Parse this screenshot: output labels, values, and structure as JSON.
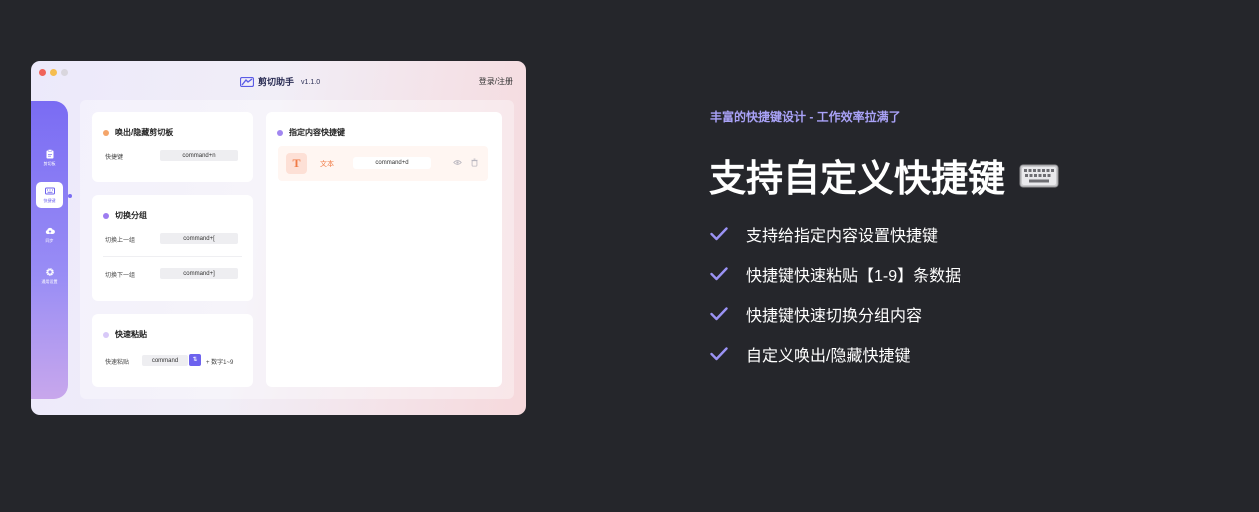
{
  "app": {
    "name": "剪切助手",
    "version": "v1.1.0",
    "login": "登录/注册"
  },
  "sidebar": {
    "items": [
      {
        "label": "剪切板",
        "icon": "clipboard-icon"
      },
      {
        "label": "快捷键",
        "icon": "keyboard-icon",
        "active": true
      },
      {
        "label": "同步",
        "icon": "cloud-upload-icon"
      },
      {
        "label": "通用设置",
        "icon": "gear-icon"
      }
    ]
  },
  "cards": {
    "toggle": {
      "title": "唤出/隐藏剪切板",
      "rows": [
        {
          "label": "快捷键",
          "value": "command+n"
        }
      ]
    },
    "group": {
      "title": "切换分组",
      "rows": [
        {
          "label": "切换上一组",
          "value": "command+["
        },
        {
          "label": "切换下一组",
          "value": "command+]"
        }
      ]
    },
    "paste": {
      "title": "快速粘贴",
      "label": "快速粘贴",
      "key": "command",
      "suffix": "+ 数字1~9"
    },
    "custom": {
      "title": "指定内容快捷键",
      "item": {
        "glyph": "T",
        "type": "文本",
        "key": "command+d"
      }
    }
  },
  "marketing": {
    "tagline": "丰富的快捷键设计 - 工作效率拉满了",
    "headline": "支持自定义快捷键",
    "features": [
      "支持给指定内容设置快捷键",
      "快捷键快速粘贴【1-9】条数据",
      "快捷键快速切换分组内容",
      "自定义唤出/隐藏快捷键"
    ]
  },
  "colors": {
    "background": "#25262b",
    "accent": "#6d62ee",
    "tagline": "#a9a2f7",
    "check": "#9b93f5"
  }
}
